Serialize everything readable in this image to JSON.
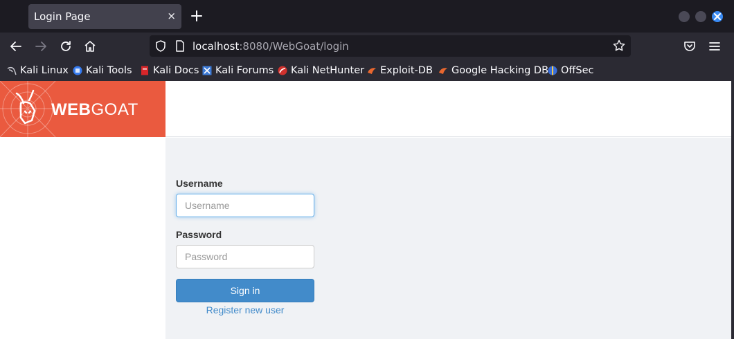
{
  "tab": {
    "title": "Login Page",
    "close": "×"
  },
  "urlbar": {
    "host": "localhost",
    "path": ":8080/WebGoat/login"
  },
  "bookmarks": [
    {
      "label": "Kali Linux",
      "icon": "kali-dragon-icon"
    },
    {
      "label": "Kali Tools",
      "icon": "kali-tools-icon"
    },
    {
      "label": "Kali Docs",
      "icon": "kali-docs-icon"
    },
    {
      "label": "Kali Forums",
      "icon": "kali-forums-icon"
    },
    {
      "label": "Kali NetHunter",
      "icon": "nethunter-icon"
    },
    {
      "label": "Exploit-DB",
      "icon": "exploit-db-icon"
    },
    {
      "label": "Google Hacking DB",
      "icon": "ghdb-icon"
    },
    {
      "label": "OffSec",
      "icon": "offsec-icon"
    }
  ],
  "logo": {
    "bold": "WEB",
    "regular": "GOAT"
  },
  "form": {
    "username_label": "Username",
    "username_placeholder": "Username",
    "password_label": "Password",
    "password_placeholder": "Password",
    "signin_label": "Sign in",
    "register_label": "Register new user"
  },
  "colors": {
    "brand": "#ea5a3f",
    "primary_button": "#428bca",
    "browser_chrome": "#2b2a33",
    "close_window": "#3a8bf4"
  }
}
